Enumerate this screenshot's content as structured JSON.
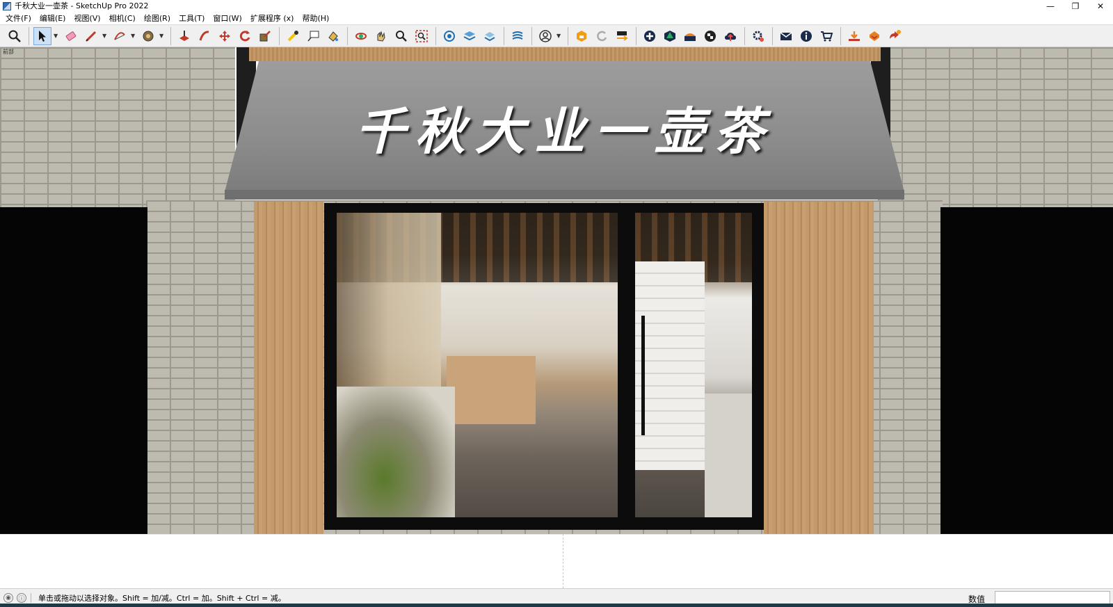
{
  "window": {
    "title": "千秋大业一壶茶 - SketchUp Pro 2022",
    "minimize": "—",
    "maximize": "❐",
    "close": "✕"
  },
  "menu": [
    {
      "label": "文件(F)"
    },
    {
      "label": "编辑(E)"
    },
    {
      "label": "视图(V)"
    },
    {
      "label": "相机(C)"
    },
    {
      "label": "绘图(R)"
    },
    {
      "label": "工具(T)"
    },
    {
      "label": "窗口(W)"
    },
    {
      "label": "扩展程序 (x)"
    },
    {
      "label": "帮助(H)"
    }
  ],
  "toolbar": {
    "icons": [
      "zoom-extents-icon",
      "select-icon",
      "eraser-icon",
      "pencil-icon",
      "arc-icon",
      "paint-bucket-icon",
      "push-pull-icon",
      "follow-me-icon",
      "move-icon",
      "rotate-icon",
      "scale-icon",
      "tape-measure-icon",
      "text-icon",
      "paint-icon",
      "orbit-icon",
      "pan-icon",
      "zoom-icon",
      "zoom-window-icon",
      "component-icon",
      "layers-icon",
      "styles-icon",
      "shadows-icon",
      "account-icon",
      "warehouse-icon",
      "refresh-icon",
      "scenes-icon",
      "add-icon",
      "extension-icon",
      "layout-icon",
      "checker-icon",
      "cloud-icon",
      "settings-icon",
      "mail-icon",
      "info-icon",
      "cart-icon",
      "import-icon",
      "export-icon",
      "plugin-icon"
    ]
  },
  "viewport": {
    "scene_label": "前部",
    "sign_text": "千秋大业一壶茶"
  },
  "status": {
    "hint": "单击或拖动以选择对象。Shift = 加/减。Ctrl = 加。Shift + Ctrl = 减。",
    "measure_label": "数值",
    "measure_value": ""
  }
}
